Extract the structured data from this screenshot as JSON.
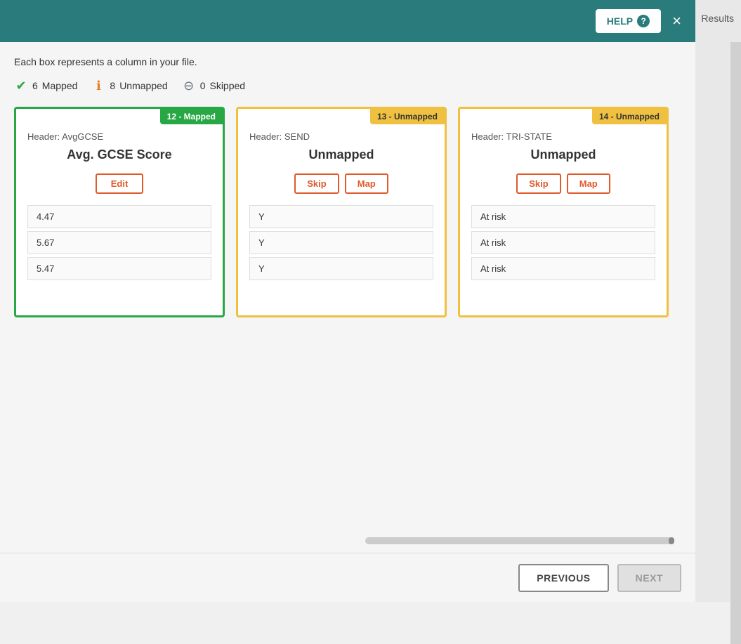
{
  "header": {
    "help_label": "HELP",
    "close_label": "×",
    "background_color": "#2a7c7c"
  },
  "description": "Each box represents a column in your file.",
  "stats": {
    "mapped_count": "6",
    "mapped_label": "Mapped",
    "unmapped_count": "8",
    "unmapped_label": "Unmapped",
    "skipped_count": "0",
    "skipped_label": "Skipped"
  },
  "cards": [
    {
      "id": "card-12",
      "badge": "12 - Mapped",
      "type": "mapped",
      "header_label": "Header: AvgGCSE",
      "title": "Avg. GCSE Score",
      "action": "edit",
      "action_label": "Edit",
      "data_rows": [
        "4.47",
        "5.67",
        "5.47"
      ]
    },
    {
      "id": "card-13",
      "badge": "13 - Unmapped",
      "type": "unmapped",
      "header_label": "Header: SEND",
      "title": "Unmapped",
      "action": "skip_map",
      "skip_label": "Skip",
      "map_label": "Map",
      "data_rows": [
        "Y",
        "Y",
        "Y"
      ]
    },
    {
      "id": "card-14",
      "badge": "14 - Unmapped",
      "type": "unmapped",
      "header_label": "Header: TRI-STATE",
      "title": "Unmapped",
      "action": "skip_map",
      "skip_label": "Skip",
      "map_label": "Map",
      "data_rows": [
        "At risk",
        "At risk",
        "At risk"
      ]
    }
  ],
  "footer": {
    "previous_label": "PREVIOUS",
    "next_label": "NEXT"
  },
  "results_text": "Results"
}
